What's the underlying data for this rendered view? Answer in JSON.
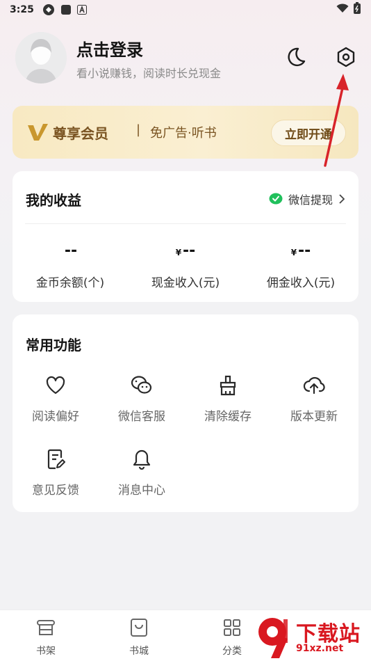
{
  "status_bar": {
    "time": "3:25",
    "icons": [
      "app-icon",
      "square-icon",
      "a-icon",
      "wifi-icon",
      "battery-icon"
    ]
  },
  "profile": {
    "title": "点击登录",
    "subtitle": "看小说赚钱，阅读时长兑现金",
    "night_mode_icon": "moon-icon",
    "settings_icon": "hexagon-settings-icon"
  },
  "vip": {
    "label": "尊享会员",
    "separator": "|",
    "subtitle": "免广告·听书",
    "button": "立即开通"
  },
  "earnings": {
    "title": "我的收益",
    "wechat_withdraw": "微信提现",
    "stats": [
      {
        "prefix": "",
        "value": "--",
        "label": "金币余额(个)"
      },
      {
        "prefix": "¥",
        "value": "--",
        "label": "现金收入(元)"
      },
      {
        "prefix": "¥",
        "value": "--",
        "label": "佣金收入(元)"
      }
    ]
  },
  "functions": {
    "title": "常用功能",
    "items": [
      {
        "label": "阅读偏好",
        "icon": "heart-icon"
      },
      {
        "label": "微信客服",
        "icon": "wechat-icon"
      },
      {
        "label": "清除缓存",
        "icon": "broom-icon"
      },
      {
        "label": "版本更新",
        "icon": "cloud-upload-icon"
      },
      {
        "label": "意见反馈",
        "icon": "feedback-icon"
      },
      {
        "label": "消息中心",
        "icon": "bell-icon"
      }
    ]
  },
  "tabbar": {
    "items": [
      {
        "label": "书架",
        "icon": "bookshelf-icon"
      },
      {
        "label": "书城",
        "icon": "bookstore-icon"
      },
      {
        "label": "分类",
        "icon": "grid-icon"
      }
    ]
  },
  "watermark": {
    "text": "下载站",
    "url": "91xz.net"
  },
  "colors": {
    "annotation_arrow": "#d8232a",
    "vip_text": "#7a5422",
    "wechat_green": "#20c05c"
  }
}
